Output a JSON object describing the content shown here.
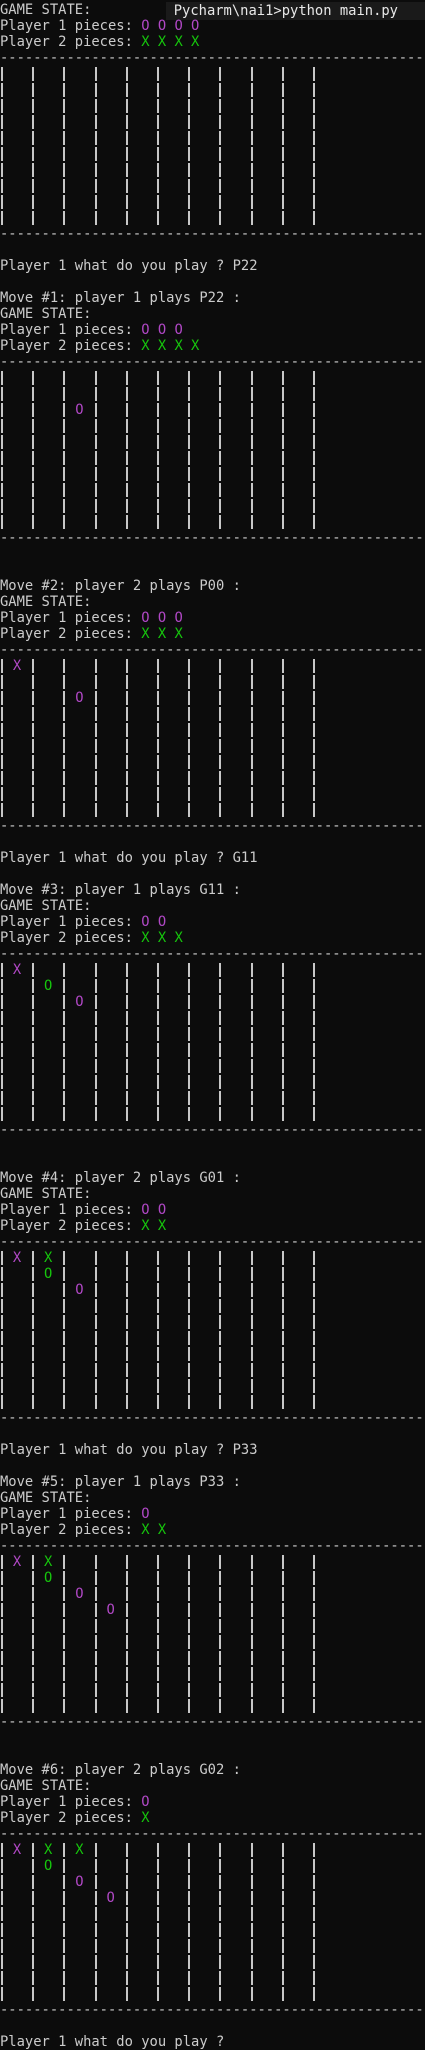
{
  "window": {
    "title": "Pycharm\\nai1>python main.py"
  },
  "colors": {
    "player1": "#16c60c",
    "player2": "#b148c6"
  },
  "dash_line": "------------------------------------------------------------",
  "blocks": [
    {
      "pre": [
        "GAME STATE:"
      ],
      "p1_label": "Player 1 pieces: ",
      "p1_pieces": "O O O O",
      "p2_label": "Player 2 pieces: ",
      "p2_pieces": "X X X X",
      "board": [],
      "post": [
        "",
        "Player 1 what do you play ? P22",
        ""
      ]
    },
    {
      "pre": [
        "Move #1: player 1 plays P22 :",
        "GAME STATE:"
      ],
      "p1_label": "Player 1 pieces: ",
      "p1_pieces": "O O O",
      "p2_label": "Player 2 pieces: ",
      "p2_pieces": "X X X X",
      "board": [
        {
          "row": 2,
          "col": 2,
          "text": "O",
          "player": 2
        }
      ],
      "post": [
        "",
        ""
      ]
    },
    {
      "pre": [
        "Move #2: player 2 plays P00 :",
        "GAME STATE:"
      ],
      "p1_label": "Player 1 pieces: ",
      "p1_pieces": "O O O",
      "p2_label": "Player 2 pieces: ",
      "p2_pieces": "X X X",
      "board": [
        {
          "row": 0,
          "col": 0,
          "text": "X",
          "player": 2
        },
        {
          "row": 2,
          "col": 2,
          "text": "O",
          "player": 2
        }
      ],
      "post": [
        "",
        "Player 1 what do you play ? G11",
        ""
      ]
    },
    {
      "pre": [
        "Move #3: player 1 plays G11 :",
        "GAME STATE:"
      ],
      "p1_label": "Player 1 pieces: ",
      "p1_pieces": "O O",
      "p2_label": "Player 2 pieces: ",
      "p2_pieces": "X X X",
      "board": [
        {
          "row": 0,
          "col": 0,
          "text": "X",
          "player": 2
        },
        {
          "row": 1,
          "col": 1,
          "text": "O",
          "player": 1
        },
        {
          "row": 2,
          "col": 2,
          "text": "O",
          "player": 2
        }
      ],
      "post": [
        "",
        ""
      ]
    },
    {
      "pre": [
        "Move #4: player 2 plays G01 :",
        "GAME STATE:"
      ],
      "p1_label": "Player 1 pieces: ",
      "p1_pieces": "O O",
      "p2_label": "Player 2 pieces: ",
      "p2_pieces": "X X",
      "board": [
        {
          "row": 0,
          "col": 0,
          "text": "X",
          "player": 2
        },
        {
          "row": 0,
          "col": 1,
          "text": "X",
          "player": 1
        },
        {
          "row": 1,
          "col": 1,
          "text": "O",
          "player": 1
        },
        {
          "row": 2,
          "col": 2,
          "text": "O",
          "player": 2
        }
      ],
      "post": [
        "",
        "Player 1 what do you play ? P33",
        ""
      ]
    },
    {
      "pre": [
        "Move #5: player 1 plays P33 :",
        "GAME STATE:"
      ],
      "p1_label": "Player 1 pieces: ",
      "p1_pieces": "O",
      "p2_label": "Player 2 pieces: ",
      "p2_pieces": "X X",
      "board": [
        {
          "row": 0,
          "col": 0,
          "text": "X",
          "player": 2
        },
        {
          "row": 0,
          "col": 1,
          "text": "X",
          "player": 1
        },
        {
          "row": 1,
          "col": 1,
          "text": "O",
          "player": 1
        },
        {
          "row": 2,
          "col": 2,
          "text": "O",
          "player": 2
        },
        {
          "row": 3,
          "col": 3,
          "text": "O",
          "player": 2
        }
      ],
      "post": [
        "",
        ""
      ]
    },
    {
      "pre": [
        "Move #6: player 2 plays G02 :",
        "GAME STATE:"
      ],
      "p1_label": "Player 1 pieces: ",
      "p1_pieces": "O",
      "p2_label": "Player 2 pieces: ",
      "p2_pieces": "X",
      "board": [
        {
          "row": 0,
          "col": 0,
          "text": "X",
          "player": 2
        },
        {
          "row": 0,
          "col": 1,
          "text": "X",
          "player": 1
        },
        {
          "row": 1,
          "col": 1,
          "text": "O",
          "player": 1
        },
        {
          "row": 0,
          "col": 2,
          "text": "X",
          "player": 1
        },
        {
          "row": 2,
          "col": 2,
          "text": "O",
          "player": 2
        },
        {
          "row": 3,
          "col": 3,
          "text": "O",
          "player": 2
        }
      ],
      "post": [
        "",
        "Player 1 what do you play ?"
      ]
    }
  ]
}
